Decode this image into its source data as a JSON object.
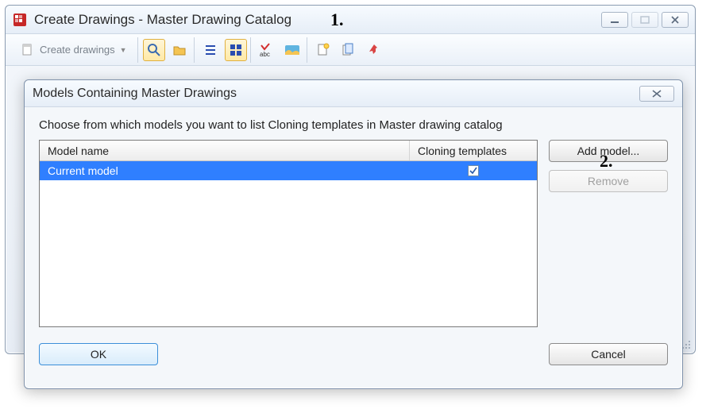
{
  "outer": {
    "title": "Create Drawings - Master Drawing Catalog"
  },
  "toolbar": {
    "create_drawings_label": "Create drawings",
    "icons": {
      "doc": "doc-new-icon",
      "search": "search-icon",
      "folder": "folder-open-icon",
      "list": "list-view-icon",
      "thumb": "thumbnail-view-icon",
      "abc": "spellcheck-icon",
      "pano": "panorama-icon",
      "newdoc": "new-document-icon",
      "copydoc": "copy-document-icon",
      "pin": "pin-icon"
    }
  },
  "dialog": {
    "title": "Models Containing Master Drawings",
    "instruction": "Choose from which models you want to list Cloning templates in Master drawing catalog",
    "columns": {
      "model_name": "Model name",
      "cloning_templates": "Cloning templates"
    },
    "rows": [
      {
        "name": "Current model",
        "cloning_checked": true
      }
    ],
    "buttons": {
      "add_model": "Add model...",
      "remove": "Remove",
      "ok": "OK",
      "cancel": "Cancel"
    }
  },
  "callouts": {
    "one": "1.",
    "two": "2."
  }
}
